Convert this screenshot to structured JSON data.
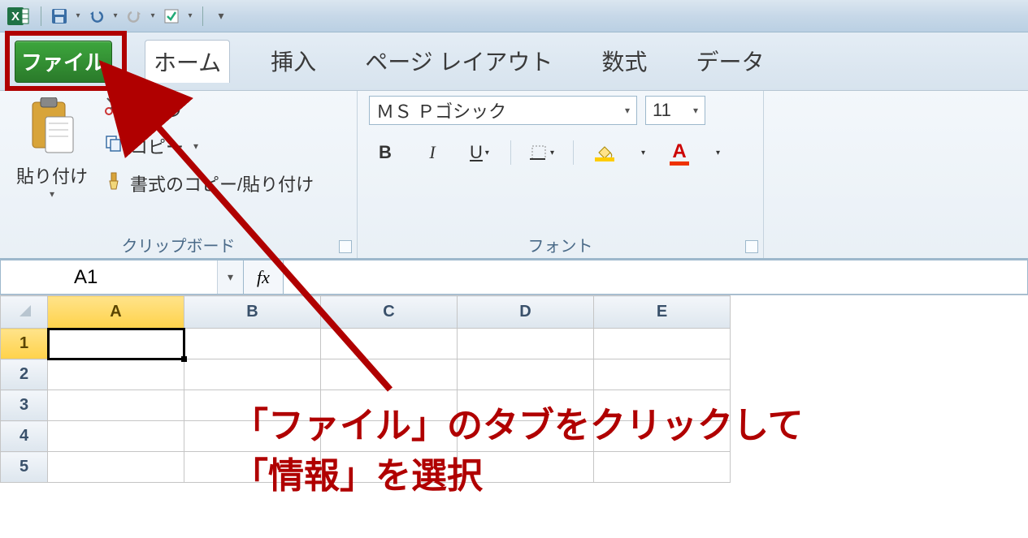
{
  "tabs": {
    "file": "ファイル",
    "home": "ホーム",
    "insert": "挿入",
    "pagelayout": "ページ レイアウト",
    "formulas": "数式",
    "data": "データ"
  },
  "clipboard": {
    "paste": "貼り付け",
    "cut": "り取り",
    "copy": "コピー",
    "formatpainter": "書式のコピー/貼り付け",
    "group_label": "クリップボード"
  },
  "font": {
    "name": "ＭＳ Ｐゴシック",
    "size": "11",
    "group_label": "フォント"
  },
  "namebox": {
    "value": "A1"
  },
  "formula": {
    "fx": "fx"
  },
  "columns": [
    "A",
    "B",
    "C",
    "D",
    "E"
  ],
  "rows": [
    "1",
    "2",
    "3",
    "4",
    "5"
  ],
  "annotation": {
    "line1": "「ファイル」のタブをクリックして",
    "line2": "「情報」を選択"
  }
}
